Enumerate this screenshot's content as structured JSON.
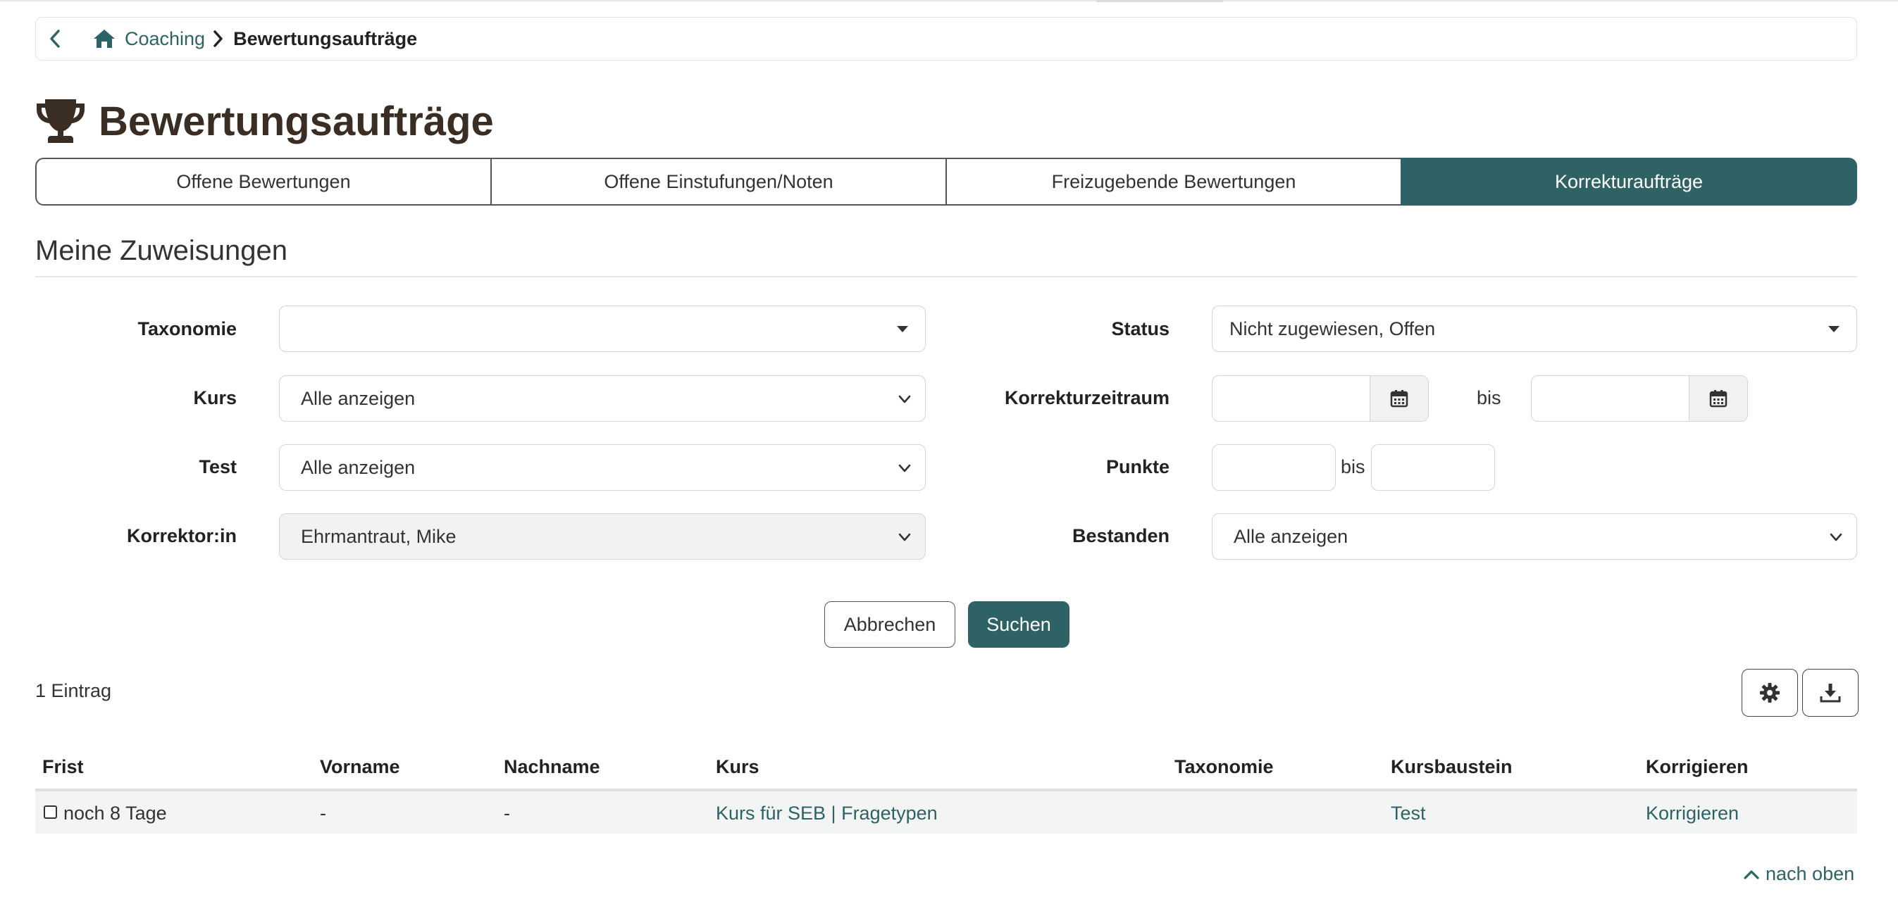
{
  "breadcrumb": {
    "home_link": "Coaching",
    "current": "Bewertungsaufträge"
  },
  "page": {
    "title": "Bewertungsaufträge"
  },
  "tabs": [
    {
      "label": "Offene Bewertungen",
      "active": false
    },
    {
      "label": "Offene Einstufungen/Noten",
      "active": false
    },
    {
      "label": "Freizugebende Bewertungen",
      "active": false
    },
    {
      "label": "Korrekturaufträge",
      "active": true
    }
  ],
  "section": {
    "title": "Meine Zuweisungen"
  },
  "filters": {
    "taxonomy_label": "Taxonomie",
    "taxonomy_value": "",
    "course_label": "Kurs",
    "course_value": "Alle anzeigen",
    "test_label": "Test",
    "test_value": "Alle anzeigen",
    "corrector_label": "Korrektor:in",
    "corrector_value": "Ehrmantraut, Mike",
    "status_label": "Status",
    "status_value": "Nicht zugewiesen, Offen",
    "period_label": "Korrekturzeitraum",
    "period_from": "",
    "period_to": "",
    "range_separator": "bis",
    "points_label": "Punkte",
    "points_from": "",
    "points_to": "",
    "passed_label": "Bestanden",
    "passed_value": "Alle anzeigen",
    "cancel_label": "Abbrechen",
    "search_label": "Suchen"
  },
  "results": {
    "count_text": "1 Eintrag"
  },
  "table": {
    "columns": [
      "Frist",
      "Vorname",
      "Nachname",
      "Kurs",
      "Taxonomie",
      "Kursbaustein",
      "Korrigieren"
    ],
    "rows": [
      {
        "frist": "noch 8 Tage",
        "vorname": "-",
        "nachname": "-",
        "kurs": "Kurs für SEB | Fragetypen",
        "taxonomie": "",
        "kursbaustein": "Test",
        "korrigieren": "Korrigieren"
      }
    ]
  },
  "footer": {
    "to_top": "nach oben"
  },
  "colors": {
    "accent": "#2e6265",
    "link": "#2d6266",
    "title": "#3a2d24"
  },
  "icons": {
    "back": "chevron-left-icon",
    "home": "home-icon",
    "separator": "chevron-right-icon",
    "title": "trophy-icon",
    "calendar": "calendar-icon",
    "settings": "gear-icon",
    "download": "download-icon",
    "to_top": "chevron-up-icon"
  }
}
